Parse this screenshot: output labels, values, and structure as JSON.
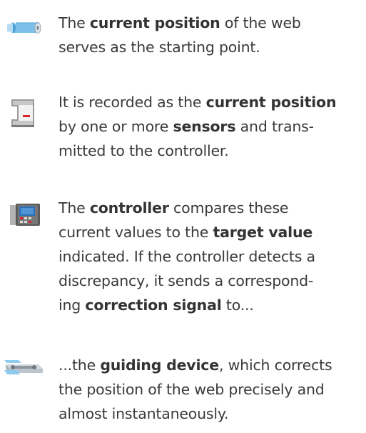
{
  "steps": [
    {
      "icon": "web-roll-icon",
      "lines": [
        [
          {
            "t": "The "
          },
          {
            "t": "current position",
            "b": true
          },
          {
            "t": " of the web"
          }
        ],
        [
          {
            "t": "serves as the starting point."
          }
        ]
      ]
    },
    {
      "icon": "sensor-icon",
      "lines": [
        [
          {
            "t": "It is recorded as the "
          },
          {
            "t": "current position",
            "b": true
          }
        ],
        [
          {
            "t": "by one or more "
          },
          {
            "t": "sensors",
            "b": true
          },
          {
            "t": " and trans-"
          }
        ],
        [
          {
            "t": "mitted to the controller."
          }
        ]
      ]
    },
    {
      "icon": "controller-icon",
      "lines": [
        [
          {
            "t": "The "
          },
          {
            "t": "controller",
            "b": true
          },
          {
            "t": " compares these"
          }
        ],
        [
          {
            "t": "current values to the "
          },
          {
            "t": "target value",
            "b": true
          }
        ],
        [
          {
            "t": "indicated. If the controller detects a"
          }
        ],
        [
          {
            "t": "discrepancy, it sends a correspond-"
          }
        ],
        [
          {
            "t": "ing "
          },
          {
            "t": "correction signal",
            "b": true
          },
          {
            "t": " to..."
          }
        ]
      ]
    },
    {
      "icon": "guiding-device-icon",
      "lines": [
        [
          {
            "t": "...the "
          },
          {
            "t": "guiding device",
            "b": true
          },
          {
            "t": ", which corrects"
          }
        ],
        [
          {
            "t": "the position of the web precisely and"
          }
        ],
        [
          {
            "t": "almost instantaneously."
          }
        ]
      ]
    }
  ],
  "colors": {
    "text": "#3a3a3a",
    "roll_blue": "#5aaee3",
    "sensor_gray": "#8c8c8c",
    "accent_red": "#d9262b",
    "controller_screen": "#2a6fb8"
  }
}
